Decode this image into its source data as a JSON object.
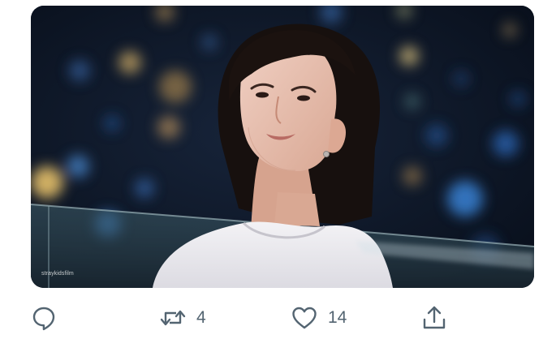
{
  "media": {
    "watermark_text": "straykidsfilm",
    "alt": ""
  },
  "actions": {
    "reply": {
      "icon": "reply-icon",
      "count": ""
    },
    "retweet": {
      "icon": "retweet-icon",
      "count": "4"
    },
    "like": {
      "icon": "heart-icon",
      "count": "14"
    },
    "share": {
      "icon": "share-icon",
      "count": ""
    }
  },
  "colors": {
    "icon": "#536471",
    "background": "#ffffff",
    "night_sky": "#0b1422"
  }
}
